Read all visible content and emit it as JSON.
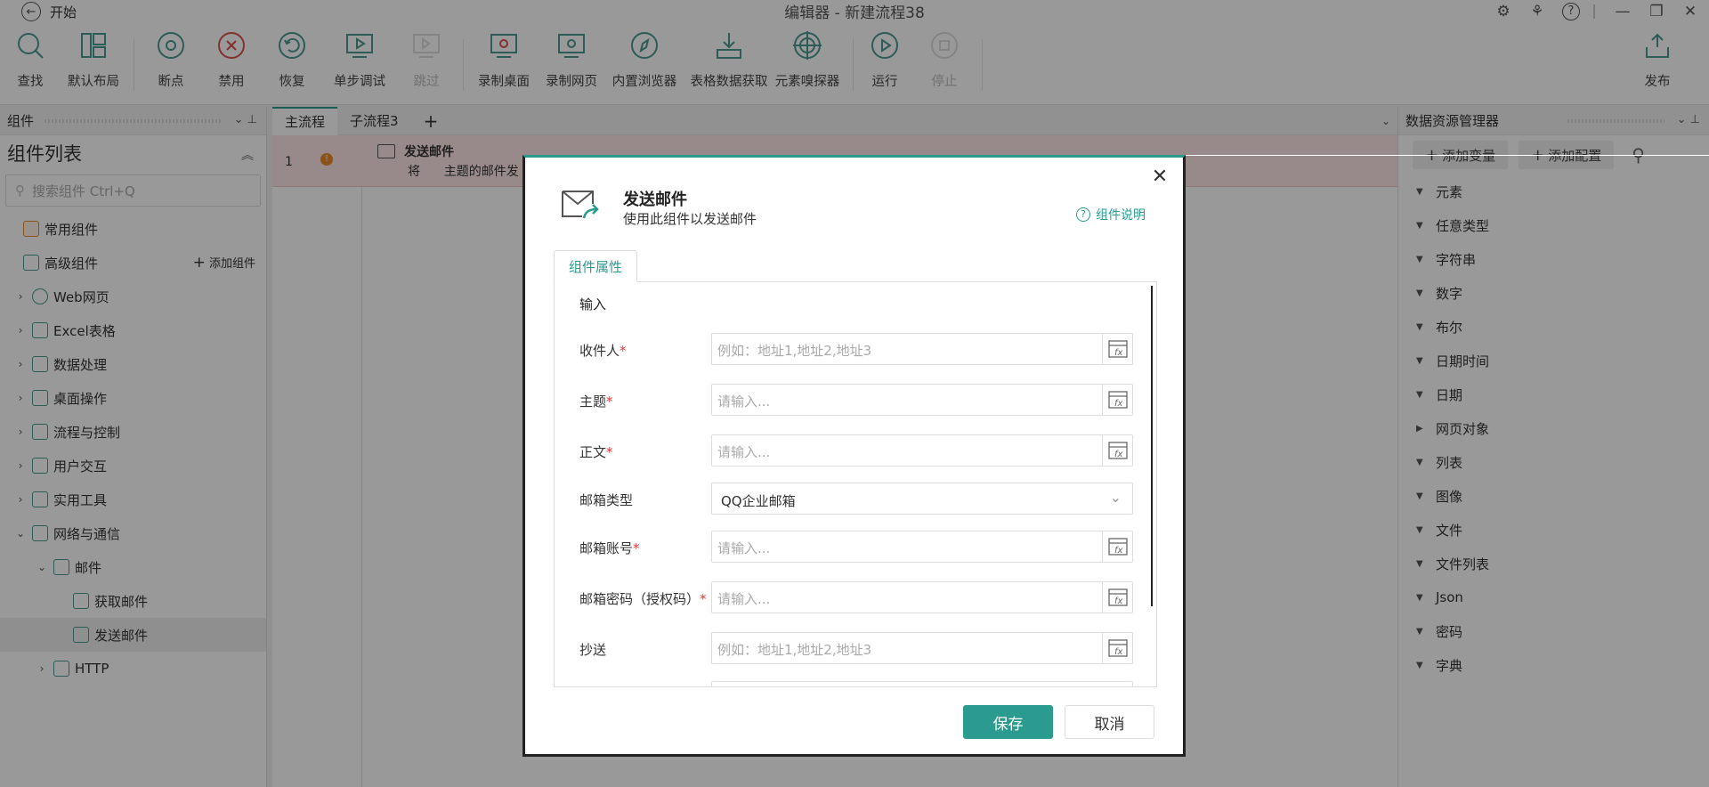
{
  "window": {
    "title": "编辑器 - 新建流程38",
    "start_label": "开始"
  },
  "toolbar": {
    "items": [
      {
        "label": "查找",
        "icon": "search-icon",
        "enabled": true
      },
      {
        "label": "默认布局",
        "icon": "layout-icon",
        "enabled": true
      },
      {
        "label": "断点",
        "icon": "breakpoint-icon",
        "enabled": true
      },
      {
        "label": "禁用",
        "icon": "disable-icon",
        "enabled": true
      },
      {
        "label": "恢复",
        "icon": "restore-icon",
        "enabled": true
      },
      {
        "label": "单步调试",
        "icon": "step-debug-icon",
        "enabled": true
      },
      {
        "label": "跳过",
        "icon": "skip-icon",
        "enabled": false
      },
      {
        "label": "录制桌面",
        "icon": "record-desktop-icon",
        "enabled": true
      },
      {
        "label": "录制网页",
        "icon": "record-web-icon",
        "enabled": true
      },
      {
        "label": "内置浏览器",
        "icon": "browser-icon",
        "enabled": true
      },
      {
        "label": "表格数据获取",
        "icon": "table-data-icon",
        "enabled": true
      },
      {
        "label": "元素嗅探器",
        "icon": "element-sniffer-icon",
        "enabled": true
      },
      {
        "label": "运行",
        "icon": "run-icon",
        "enabled": true
      },
      {
        "label": "停止",
        "icon": "stop-icon",
        "enabled": false
      },
      {
        "label": "发布",
        "icon": "publish-icon",
        "enabled": true
      }
    ]
  },
  "left_panel": {
    "header": "组件",
    "list_title": "组件列表",
    "search_placeholder": "搜索组件 Ctrl+Q",
    "add_component": "添加组件",
    "items": [
      {
        "label": "常用组件"
      },
      {
        "label": "高级组件"
      },
      {
        "label": "Web网页"
      },
      {
        "label": "Excel表格"
      },
      {
        "label": "数据处理"
      },
      {
        "label": "桌面操作"
      },
      {
        "label": "流程与控制"
      },
      {
        "label": "用户交互"
      },
      {
        "label": "实用工具"
      },
      {
        "label": "网络与通信"
      },
      {
        "label": "邮件"
      },
      {
        "label": "获取邮件"
      },
      {
        "label": "发送邮件"
      },
      {
        "label": "HTTP"
      }
    ]
  },
  "tabs": {
    "items": [
      "主流程",
      "子流程3"
    ],
    "add": "+"
  },
  "flow": {
    "row": {
      "number": "1",
      "name": "发送邮件",
      "desc": "将",
      "desc2": "主题的邮件发"
    }
  },
  "right_panel": {
    "header": "数据资源管理器",
    "add_variable": "添加变量",
    "add_config": "添加配置",
    "items": [
      "元素",
      "任意类型",
      "字符串",
      "数字",
      "布尔",
      "日期时间",
      "日期",
      "网页对象",
      "列表",
      "图像",
      "文件",
      "文件列表",
      "Json",
      "密码",
      "字典"
    ]
  },
  "dialog": {
    "title": "发送邮件",
    "subtitle": "使用此组件以发送邮件",
    "help": "组件说明",
    "tab": "组件属性",
    "section": "输入",
    "fields": [
      {
        "label": "收件人",
        "required": true,
        "placeholder": "例如：地址1,地址2,地址3"
      },
      {
        "label": "主题",
        "required": true,
        "placeholder": "请输入..."
      },
      {
        "label": "正文",
        "required": true,
        "placeholder": "请输入..."
      },
      {
        "label": "邮箱类型",
        "required": false,
        "value": "QQ企业邮箱"
      },
      {
        "label": "邮箱账号",
        "required": true,
        "placeholder": "请输入..."
      },
      {
        "label": "邮箱密码（授权码）",
        "required": true,
        "placeholder": "请输入..."
      },
      {
        "label": "抄送",
        "required": false,
        "placeholder": "例如：地址1,地址2,地址3"
      }
    ],
    "save": "保存",
    "cancel": "取消"
  },
  "colors": {
    "accent": "#2a9b8e",
    "required": "#e53935",
    "error_row": "#fde7e7"
  }
}
